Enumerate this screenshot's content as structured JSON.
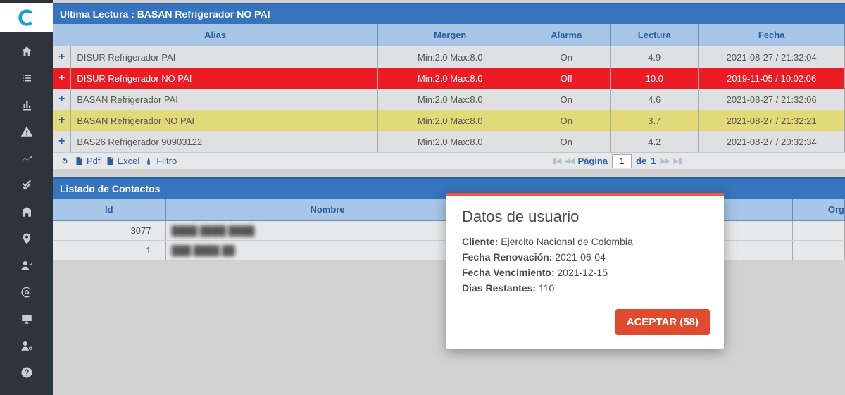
{
  "panel1": {
    "title": "Ultima Lectura : BASAN Refrigerador NO PAI",
    "headers": {
      "alias": "Alias",
      "margen": "Margen",
      "alarma": "Alarma",
      "lectura": "Lectura",
      "fecha": "Fecha"
    },
    "rows": [
      {
        "state": "normal",
        "alias": "DISUR Refrigerador PAI",
        "margen": "Min:2.0 Max:8.0",
        "alarma": "On",
        "lectura": "4.9",
        "fecha": "2021-08-27 / 21:32:04"
      },
      {
        "state": "red",
        "alias": "DISUR Refrigerador NO PAI",
        "margen": "Min:2.0 Max:8.0",
        "alarma": "Off",
        "lectura": "10.0",
        "fecha": "2019-11-05 / 10:02:06"
      },
      {
        "state": "normal",
        "alias": "BASAN Refrigerador PAI",
        "margen": "Min:2.0 Max:8.0",
        "alarma": "On",
        "lectura": "4.6",
        "fecha": "2021-08-27 / 21:32:06"
      },
      {
        "state": "yellow",
        "alias": "BASAN Refrigerador NO PAI",
        "margen": "Min:2.0 Max:8.0",
        "alarma": "On",
        "lectura": "3.7",
        "fecha": "2021-08-27 / 21:32:21"
      },
      {
        "state": "normal",
        "alias": "BAS26 Refrigerador 90903122",
        "margen": "Min:2.0 Max:8.0",
        "alarma": "On",
        "lectura": "4.2",
        "fecha": "2021-08-27 / 20:32:34"
      }
    ],
    "toolbar": {
      "pdf": "Pdf",
      "excel": "Excel",
      "filtro": "Filtro"
    },
    "pager": {
      "pagina": "Página",
      "current": "1",
      "de": "de",
      "total": "1"
    }
  },
  "panel2": {
    "title": "Listado de Contactos",
    "headers": {
      "id": "Id",
      "nombre": "Nombre",
      "org": "Org"
    },
    "rows": [
      {
        "id": "3077",
        "nombre": "████ ████ ████"
      },
      {
        "id": "1",
        "nombre": "███ ████ ██"
      }
    ]
  },
  "modal": {
    "title": "Datos de usuario",
    "cliente_label": "Cliente:",
    "cliente_value": "Ejercito Nacional de Colombia",
    "renov_label": "Fecha Renovación:",
    "renov_value": "2021-06-04",
    "venc_label": "Fecha Vencimiento:",
    "venc_value": "2021-12-15",
    "dias_label": "Dias Restantes:",
    "dias_value": "110",
    "button": "ACEPTAR (58)"
  }
}
